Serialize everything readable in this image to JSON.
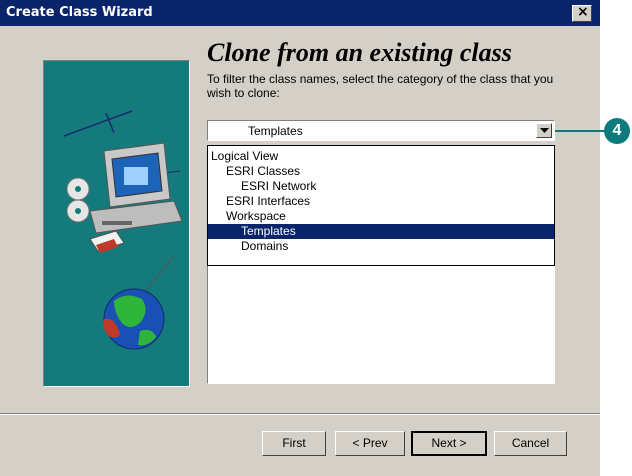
{
  "window": {
    "title": "Create Class Wizard",
    "close_glyph": "×"
  },
  "page": {
    "heading": "Clone from an existing class",
    "instruction": "To filter the class names, select the category of the class that you wish to clone:"
  },
  "category_combo": {
    "selected": "Templates",
    "arrow_icon": "chevron-down-icon"
  },
  "dropdown": {
    "items": [
      {
        "label": "Logical View",
        "indent": 0,
        "selected": false
      },
      {
        "label": "ESRI Classes",
        "indent": 1,
        "selected": false
      },
      {
        "label": "ESRI Network",
        "indent": 2,
        "selected": false
      },
      {
        "label": "ESRI Interfaces",
        "indent": 1,
        "selected": false
      },
      {
        "label": "Workspace",
        "indent": 1,
        "selected": false
      },
      {
        "label": "Templates",
        "indent": 2,
        "selected": true
      },
      {
        "label": "Domains",
        "indent": 2,
        "selected": false
      }
    ]
  },
  "buttons": {
    "first": "First",
    "prev": "< Prev",
    "next": "Next >",
    "cancel": "Cancel"
  },
  "callout": {
    "number": "4",
    "color": "#0e7a7e"
  },
  "colors": {
    "titlebar": "#0a246a",
    "selection": "#0a246a",
    "art_background": "#157a7c",
    "dialog": "#d4d0c8"
  }
}
